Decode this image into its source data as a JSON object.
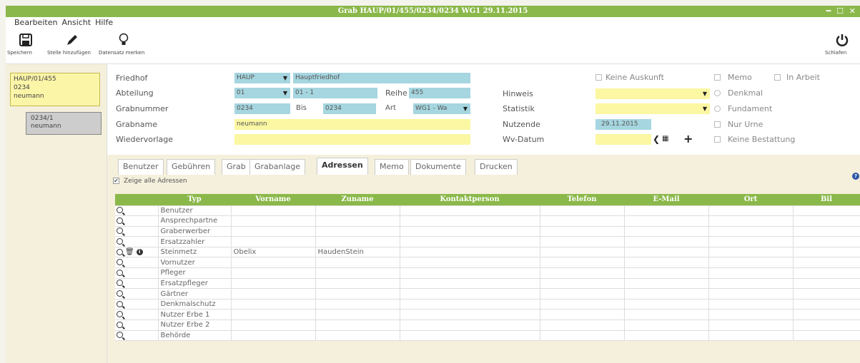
{
  "window": {
    "title": "Grab HAUP/01/455/0234/0234 WG1 29.11.2015",
    "controls": "━ ☐ ✕"
  },
  "menu": [
    "Bearbeiten",
    "Ansicht",
    "Hilfe"
  ],
  "toolbar": {
    "save": "Speichern",
    "add_site": "Stelle hinzufügen",
    "mark": "Datensatz merken",
    "sleep": "Schlafen"
  },
  "tree": {
    "item1": [
      "HAUP/01/455",
      "0234",
      "neumann"
    ],
    "item2": [
      "0234/1",
      "neumann"
    ]
  },
  "form": {
    "labels": {
      "friedhof": "Friedhof",
      "abteilung": "Abteilung",
      "grabnummer": "Grabnummer",
      "grabname": "Grabname",
      "wiedervorlage": "Wiedervorlage",
      "reihe": "Reihe",
      "bis": "Bis",
      "art": "Art",
      "hinweis": "Hinweis",
      "statistik": "Statistik",
      "nutzende": "Nutzende",
      "wvdatum": "Wv-Datum"
    },
    "values": {
      "friedhof_code": "HAUP",
      "friedhof_name": "Hauptfriedhof",
      "abteilung_code": "01",
      "abteilung_name": "01 - 1",
      "reihe": "455",
      "grabnummer": "0234",
      "bis": "0234",
      "art": "WG1 - Wa",
      "grabname": "neumann",
      "nutzende": "29.11.2015"
    },
    "checks": {
      "keine_auskunft": "Keine Auskunft",
      "memo": "Memo",
      "in_arbeit": "In Arbeit",
      "denkmal": "Denkmal",
      "fundament": "Fundament",
      "nur_urne": "Nur Urne",
      "keine_bestattung": "Keine Bestattung"
    }
  },
  "tabs": [
    "Benutzer",
    "Gebühren",
    "Grab",
    "Grabanlage",
    "Adressen",
    "Memo",
    "Dokumente",
    "Drucken"
  ],
  "show_all_label": "Zeige alle Adressen",
  "table": {
    "columns": [
      "Typ",
      "Vorname",
      "Zuname",
      "Kontaktperson",
      "Telefon",
      "E-Mail",
      "Ort",
      "Bil"
    ],
    "rows": [
      {
        "typ": "Benutzer",
        "vorname": "",
        "zuname": ""
      },
      {
        "typ": "Ansprechpartne",
        "vorname": "",
        "zuname": ""
      },
      {
        "typ": "Graberwerber",
        "vorname": "",
        "zuname": ""
      },
      {
        "typ": "Ersatzzahler",
        "vorname": "",
        "zuname": ""
      },
      {
        "typ": "Steinmetz",
        "vorname": "Obelix",
        "zuname": "HaudenStein"
      },
      {
        "typ": "Vornutzer",
        "vorname": "",
        "zuname": ""
      },
      {
        "typ": "Pfleger",
        "vorname": "",
        "zuname": ""
      },
      {
        "typ": "Ersatzpfleger",
        "vorname": "",
        "zuname": ""
      },
      {
        "typ": "Gärtner",
        "vorname": "",
        "zuname": ""
      },
      {
        "typ": "Denkmalschutz",
        "vorname": "",
        "zuname": ""
      },
      {
        "typ": "Nutzer Erbe 1",
        "vorname": "",
        "zuname": ""
      },
      {
        "typ": "Nutzer Erbe 2",
        "vorname": "",
        "zuname": ""
      },
      {
        "typ": "Behörde",
        "vorname": "",
        "zuname": ""
      }
    ]
  },
  "colors": {
    "accent_green": "#8bb84a",
    "field_blue": "#a6d6e0",
    "field_yellow": "#fbf7a2"
  }
}
